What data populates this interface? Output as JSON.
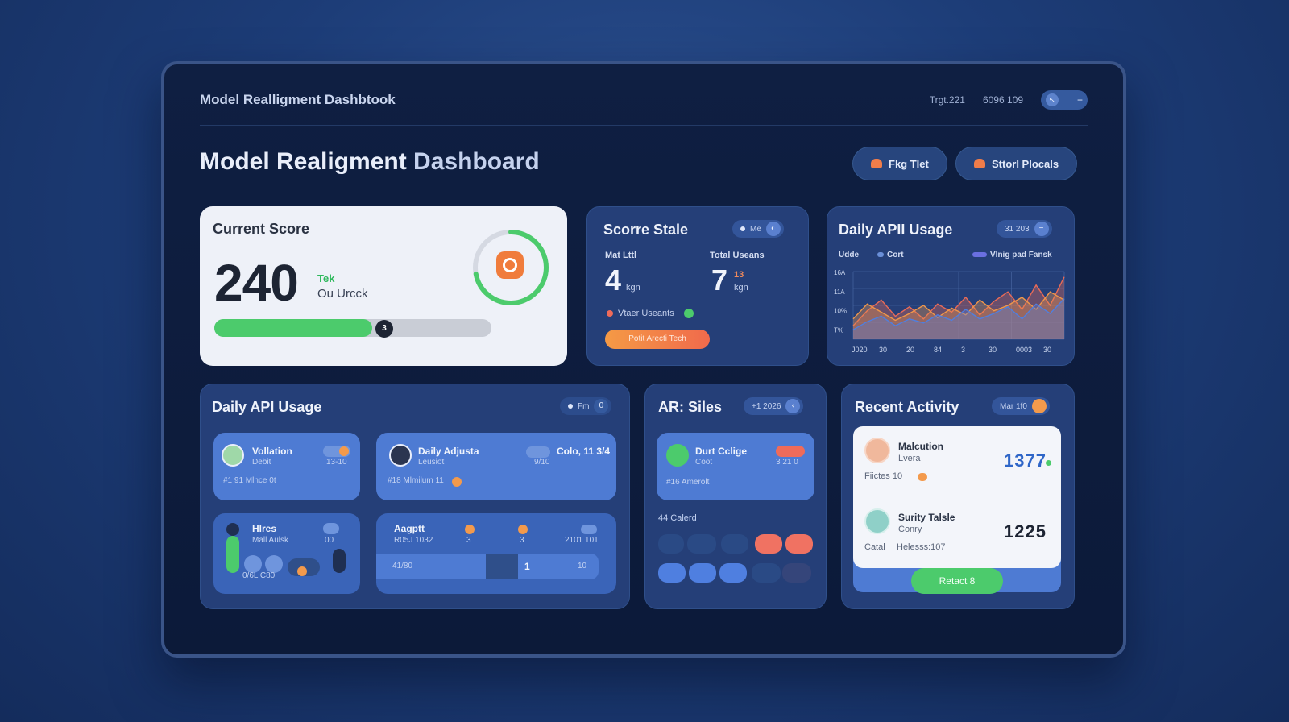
{
  "app": {
    "window_title": "Model Realligment Dashbtook",
    "top_meta_1": "Trgt.221",
    "top_meta_2": "6096 109",
    "page_title_strong": "Model Realigment",
    "page_title_muted": "Dashboard"
  },
  "header_buttons": [
    {
      "label": "Fkg Tlet",
      "icon": "flame-icon"
    },
    {
      "label": "Sttorl Plocals",
      "icon": "flame-icon"
    }
  ],
  "current_score": {
    "title": "Current Score",
    "value": "240",
    "tag": "Tek",
    "sub": "Ou Urcck",
    "progress_step": "3",
    "progress_fraction": 0.57,
    "ring_fraction": 0.72,
    "colors": {
      "green": "#4ccb6c",
      "orange": "#f07c3c"
    }
  },
  "score_stale": {
    "title": "Scorre Stale",
    "pill_label": "Me",
    "col1_label": "Mat Lttl",
    "col1_value": "4",
    "col1_unit": "kgn",
    "col2_label": "Total Useans",
    "col2_value": "7",
    "col2_super": "13",
    "col2_unit": "kgn",
    "legend": "Vtaer Useants",
    "button": "Potit Arecti Tech"
  },
  "daily_api_top": {
    "title": "Daily APII Usage",
    "pill_label": "31 203",
    "legend_1": "Udde",
    "legend_2": "Cort",
    "legend_3": "Vlnig pad Fansk",
    "y_ticks": [
      "16A",
      "11A",
      "10%",
      "T%"
    ],
    "x_ticks": [
      "J020",
      "30",
      "20",
      "84",
      "3",
      "30",
      "0003",
      "30"
    ]
  },
  "chart_data": {
    "type": "area",
    "x": [
      "J020",
      "30",
      "20",
      "84",
      "3",
      "30",
      "0003",
      "30"
    ],
    "series": [
      {
        "values": [
          20,
          42,
          58,
          34,
          48,
          30,
          52,
          40,
          62,
          36,
          56,
          70,
          44,
          80,
          50,
          92
        ],
        "color": "#e96b57"
      },
      {
        "values": [
          30,
          52,
          40,
          28,
          38,
          50,
          32,
          46,
          36,
          58,
          42,
          50,
          62,
          44,
          70,
          58
        ],
        "color": "#f0974a"
      },
      {
        "values": [
          14,
          26,
          34,
          20,
          30,
          24,
          36,
          28,
          44,
          30,
          38,
          48,
          30,
          52,
          38,
          60
        ],
        "color": "#4f7fe0"
      }
    ],
    "ylim": [
      0,
      100
    ],
    "grid": true
  },
  "daily_api_bottom": {
    "title": "Daily API Usage",
    "pill_label": "Fm",
    "pill_value": "0",
    "tiles": [
      {
        "name": "Vollation",
        "sub": "Debit",
        "meta": "#1 91 Mlnce 0t",
        "right": "13-10"
      },
      {
        "name": "Daily Adjusta",
        "sub": "Leusiot",
        "meta": "#18 Mlmilum 11",
        "right_label": "Colo, 11 3/4",
        "right_sub": "9/10"
      },
      {
        "name": "Hlres",
        "sub": "Mall Aulsk",
        "meta": "0/6L C80",
        "right": "00"
      },
      {
        "name": "Aagptt",
        "sub": "R05J 1032",
        "c2": "3",
        "c3": "3",
        "c4": "2101 101",
        "row_left": "41/80",
        "row_mid": "1",
        "row_right": "10"
      }
    ]
  },
  "ar_siles": {
    "title": "AR: Siles",
    "pill_label": "+1 2026",
    "tile_name": "Durt Cclige",
    "tile_sub": "Coot",
    "tile_meta": "#16 Amerolt",
    "tile_right": "3 21 0",
    "section_label": "44 Calerd"
  },
  "recent_activity": {
    "title": "Recent Activity",
    "pill_label": "Mar 1f0",
    "items": [
      {
        "name": "Malcution",
        "sub": "Lvera",
        "meta": "Fiictes 10",
        "value": "1377",
        "value_color": "#2f66c8"
      },
      {
        "name": "Surity Talsle",
        "sub": "Conry",
        "meta_1": "Catal",
        "meta_2": "Helesss:107",
        "value": "1225",
        "value_color": "#1d2433"
      }
    ],
    "button": "Retact 8"
  }
}
